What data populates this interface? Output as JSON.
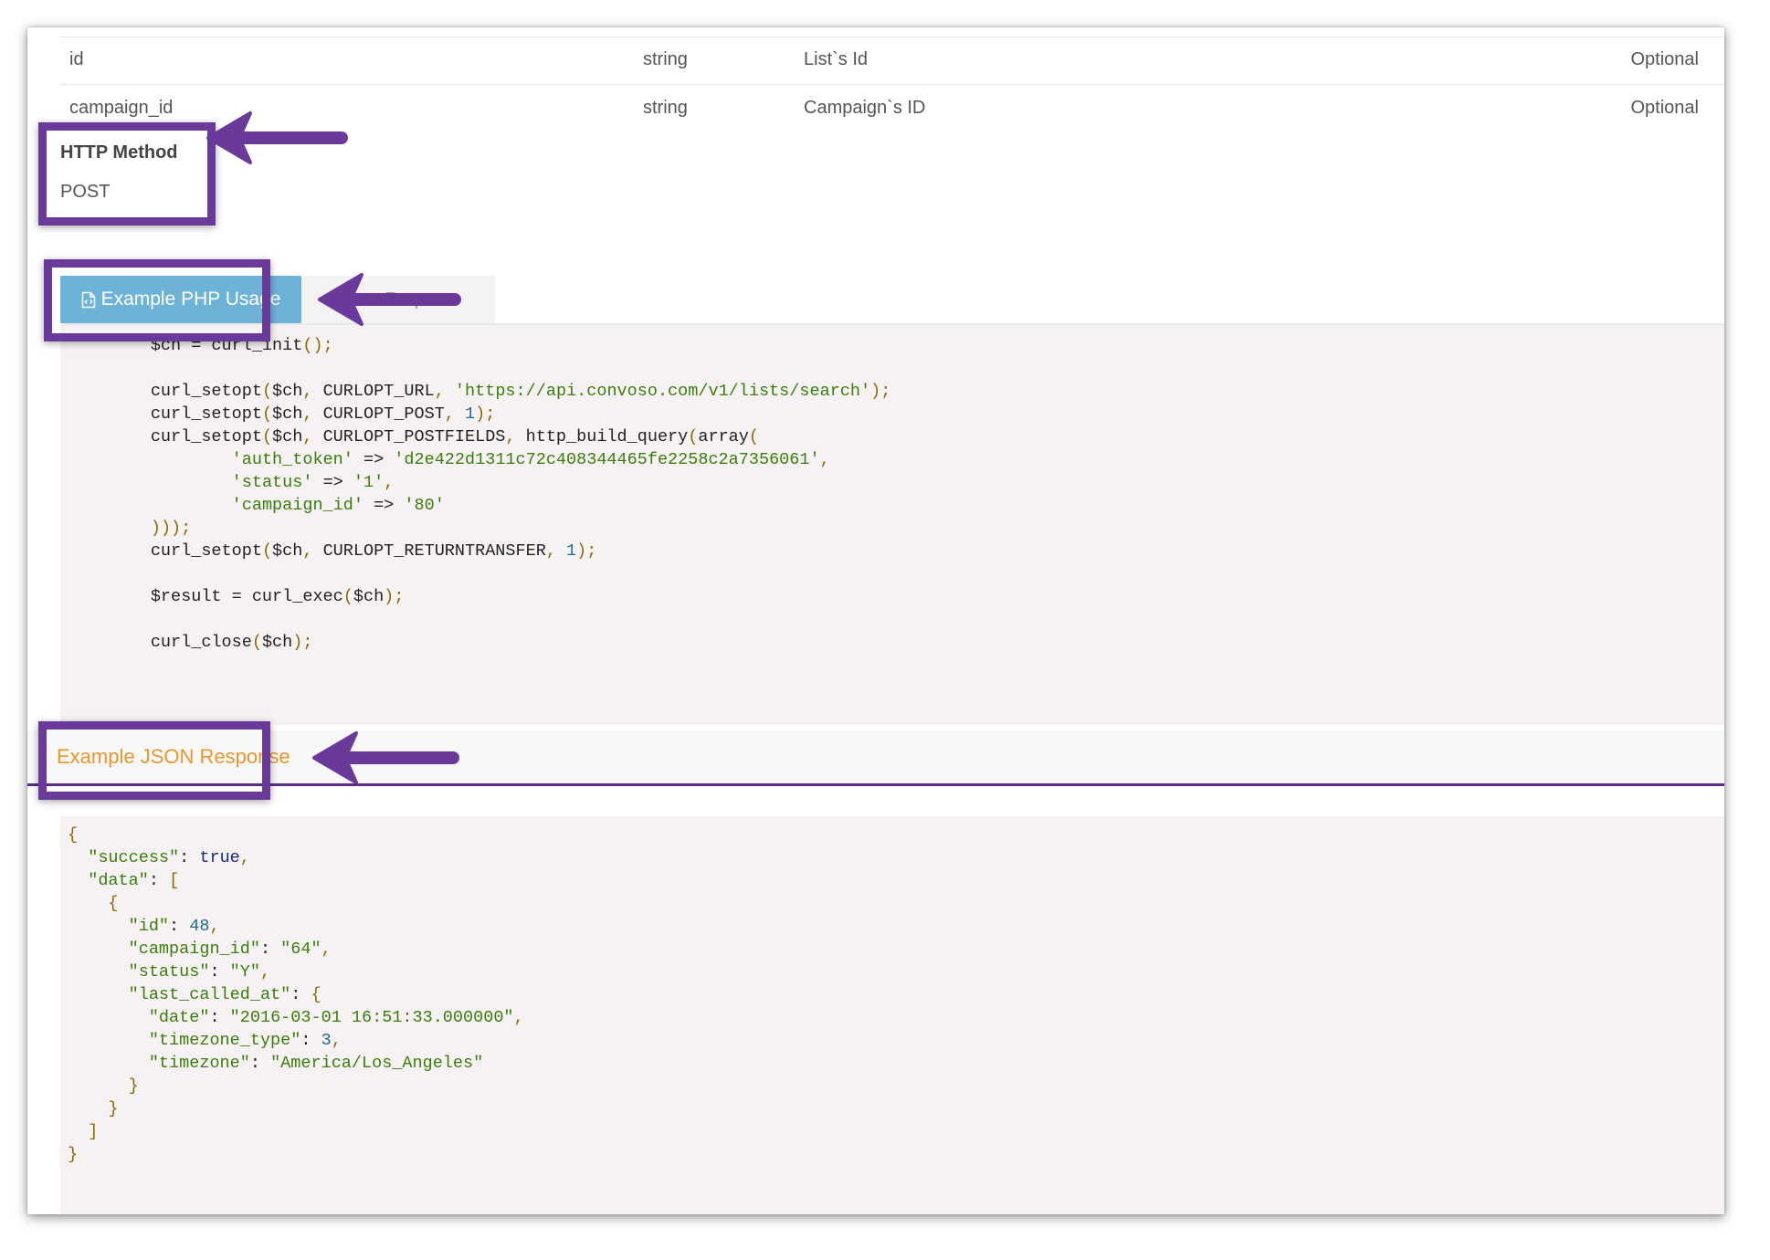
{
  "params_table": {
    "rows": [
      {
        "name": "id",
        "type": "string",
        "description": "List`s Id",
        "requirement": "Optional"
      },
      {
        "name": "campaign_id",
        "type": "string",
        "description": "Campaign`s ID",
        "requirement": "Optional"
      }
    ]
  },
  "http_method": {
    "title": "HTTP Method",
    "value": "POST"
  },
  "tabs": {
    "php_usage_label": "Example PHP Usage",
    "php_usage_icon": "file-code-icon",
    "raw_request_label": "Raw Request"
  },
  "php_code": {
    "lines": [
      "        $ch = curl_init();",
      "",
      "        curl_setopt($ch, CURLOPT_URL, 'https://api.convoso.com/v1/lists/search');",
      "        curl_setopt($ch, CURLOPT_POST, 1);",
      "        curl_setopt($ch, CURLOPT_POSTFIELDS, http_build_query(array(",
      "                'auth_token' => 'd2e422d1311c72c408344465fe2258c2a7356061',",
      "                'status' => '1',",
      "                'campaign_id' => '80'",
      "        )));",
      "        curl_setopt($ch, CURLOPT_RETURNTRANSFER, 1);",
      "",
      "        $result = curl_exec($ch);",
      "",
      "        curl_close($ch);"
    ]
  },
  "json_response": {
    "tab_label": "Example JSON Response",
    "lines": [
      "{",
      "  \"success\": true,",
      "  \"data\": [",
      "    {",
      "      \"id\": 48,",
      "      \"campaign_id\": \"64\",",
      "      \"status\": \"Y\",",
      "      \"last_called_at\": {",
      "        \"date\": \"2016-03-01 16:51:33.000000\",",
      "        \"timezone_type\": 3,",
      "        \"timezone\": \"America/Los_Angeles\"",
      "      }",
      "    }",
      "  ]",
      "}"
    ]
  },
  "colors": {
    "annotation_purple": "#6a3a9a",
    "tab_active_blue": "#6db3d8",
    "json_tab_orange": "#e8962e",
    "code_background": "#f6f2f3"
  }
}
